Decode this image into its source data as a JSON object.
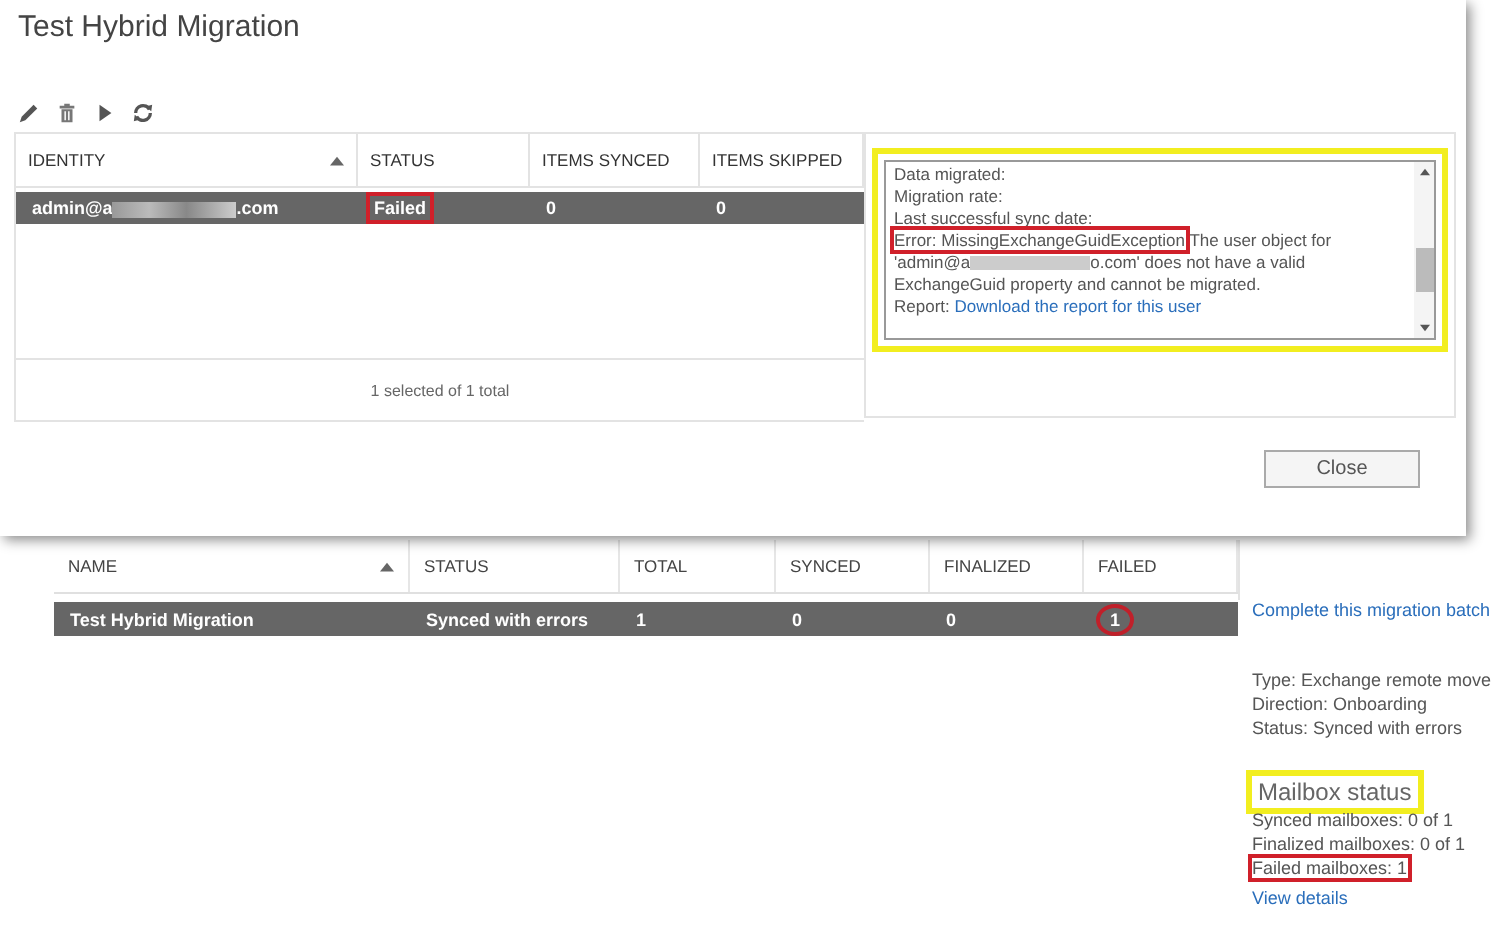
{
  "dialog": {
    "title": "Test Hybrid Migration",
    "table": {
      "columns": [
        {
          "label": "IDENTITY",
          "sorted": true
        },
        {
          "label": "STATUS",
          "sorted": false
        },
        {
          "label": "ITEMS SYNCED",
          "sorted": false
        },
        {
          "label": "ITEMS SKIPPED",
          "sorted": false
        }
      ],
      "rows": [
        {
          "identity_start": "admin@a",
          "identity_end": ".com",
          "status": "Failed",
          "status_boxed": true,
          "items_synced": "0",
          "items_skipped": "0",
          "selected": true
        }
      ],
      "footer": "1 selected of 1 total"
    },
    "details": {
      "framed": true,
      "lines": [
        "Data migrated:",
        "Migration rate:",
        "Last successful sync date:"
      ],
      "error_label": "Error: MissingExchangeGuidException",
      "error_boxed": true,
      "error_text_start": "The user object for 'admin@a",
      "error_text_end": "o.com' does not have a valid ExchangeGuid property and cannot be migrated.",
      "report_label": "Report:",
      "report_link": "Download the report for this user"
    },
    "close_button": "Close"
  },
  "batches": {
    "columns": [
      {
        "label": "NAME",
        "sorted": true
      },
      {
        "label": "STATUS",
        "sorted": false
      },
      {
        "label": "TOTAL",
        "sorted": false
      },
      {
        "label": "SYNCED",
        "sorted": false
      },
      {
        "label": "FINALIZED",
        "sorted": false
      },
      {
        "label": "FAILED",
        "sorted": false
      }
    ],
    "rows": [
      {
        "cells": [
          {
            "text": "Test Hybrid Migration",
            "circled": false
          },
          {
            "text": "Synced with errors",
            "circled": false
          },
          {
            "text": "1",
            "circled": false
          },
          {
            "text": "0",
            "circled": false
          },
          {
            "text": "0",
            "circled": false
          },
          {
            "text": "1",
            "circled": true
          }
        ],
        "selected": true
      }
    ]
  },
  "side_panel": {
    "link": "Complete this migration batch",
    "info": [
      "Type: Exchange remote move",
      "Direction: Onboarding",
      "Status: Synced with errors"
    ],
    "heading": "Mailbox status",
    "heading_framed": true,
    "stats": [
      {
        "text": "Synced mailboxes: 0 of 1",
        "boxed": false
      },
      {
        "text": "Finalized mailboxes: 0 of 1",
        "boxed": false
      },
      {
        "text": "Failed mailboxes: 1",
        "boxed": true
      }
    ],
    "view_details": "View details"
  }
}
